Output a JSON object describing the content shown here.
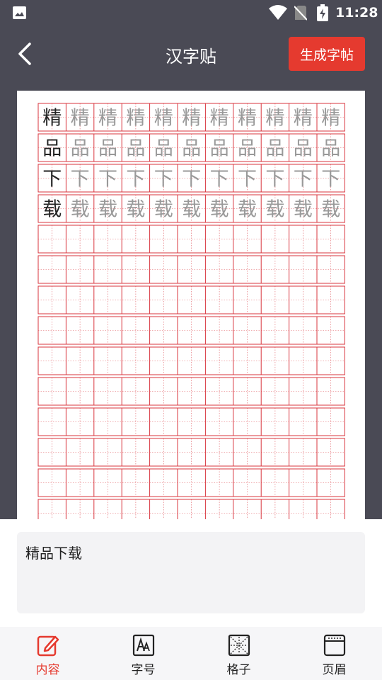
{
  "status_bar": {
    "time": "11:28"
  },
  "header": {
    "title": "汉字贴",
    "generate_label": "生成字帖"
  },
  "practice_sheet": {
    "characters": [
      "精",
      "品",
      "下",
      "载"
    ],
    "columns": 11,
    "rows": 14,
    "grid_color": "#d9363e",
    "model_char_color": "#222222",
    "trace_char_color": "#999999"
  },
  "content_input": {
    "value": "精品下载"
  },
  "tabs": [
    {
      "label": "内容",
      "icon": "edit-icon",
      "active": true
    },
    {
      "label": "字号",
      "icon": "font-size-icon",
      "active": false
    },
    {
      "label": "格子",
      "icon": "grid-icon",
      "active": false
    },
    {
      "label": "页眉",
      "icon": "header-icon",
      "active": false
    }
  ],
  "colors": {
    "accent": "#e53a2f",
    "toolbar_bg": "#4a4a55"
  }
}
